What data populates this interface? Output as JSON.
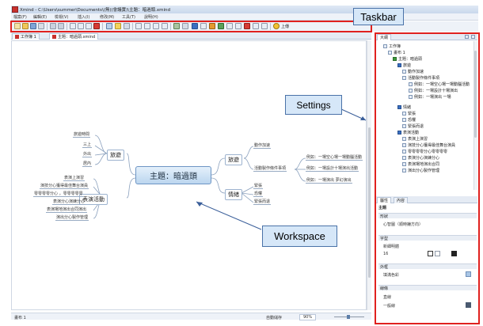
{
  "window": {
    "title": "Xmind - C:\\Users\\summer\\Documents\\(無)(會議實)\\主題：暗過頭.xmind"
  },
  "menubar": {
    "items": [
      "檔案(F)",
      "編輯(E)",
      "檢視(V)",
      "插入(I)",
      "修改(M)",
      "工具(T)",
      "說明(H)"
    ]
  },
  "toolbar": {
    "share_label": "上傳",
    "accent": "#e0211f"
  },
  "callouts": {
    "taskbar": "Taskbar",
    "settings": "Settings",
    "workspace": "Workspace"
  },
  "editor": {
    "tabs": [
      "工作簿 1",
      "主題：暗過頭.xmind"
    ],
    "status_left": "畫布 1",
    "zoom": "90%",
    "status_mid": "自動儲存"
  },
  "map": {
    "central": "主題：暗過頭",
    "left_topics": [
      {
        "label": "旅遊",
        "children": [
          "旅遊時間",
          "三上",
          "外出",
          "居內"
        ]
      },
      {
        "label": "表演活動",
        "children": [
          "表演上演習",
          "演技分心獲得最佳舞台演員",
          "零零零零分心 ，零零零零零",
          "表演分心演練分心",
          "表演場地演出合同演出",
          "演出分心製作管理"
        ]
      }
    ],
    "right_topics": [
      {
        "label": "旅遊",
        "children": [
          "動作加速",
          "活動製作條件事項"
        ],
        "grandchildren": [
          "例如：一場空心場一場動腦活動",
          "例如：一場設計十場演出活動",
          "例如：一場演出 夢幻演出"
        ]
      },
      {
        "label": "情緒",
        "children": [
          "緊張",
          "恐懼",
          "緊張而退"
        ]
      }
    ]
  },
  "outline": {
    "tab": "大綱",
    "rows": [
      "工作簿",
      "畫布 1",
      "主題：暗過頭",
      "旅遊",
      "動作加速",
      "活動製作條件事項",
      "例如：一場空心場一場動腦活動",
      "例如：一場設計十場演出",
      "例如：一場演出 一場",
      "情緒",
      "緊張",
      "恐懼",
      "緊張而退",
      "表演活動",
      "表演上演習",
      "演技分心獲得最佳舞台演員",
      "零零零零分心零零零零",
      "表演分心演練分心",
      "表演場地演出合同",
      "演出分心製作管理"
    ]
  },
  "properties": {
    "tabs": [
      "屬性",
      "內容"
    ],
    "header": "主題",
    "sections": [
      "形狀",
      "字型",
      "外框",
      "線條"
    ],
    "structure_value": "心智圖（順時鐘方向）",
    "font_name": "新細明體",
    "font_size": "16",
    "fill_label": "填滿色彩",
    "line_label": "直線",
    "line_label2": "一般線"
  }
}
